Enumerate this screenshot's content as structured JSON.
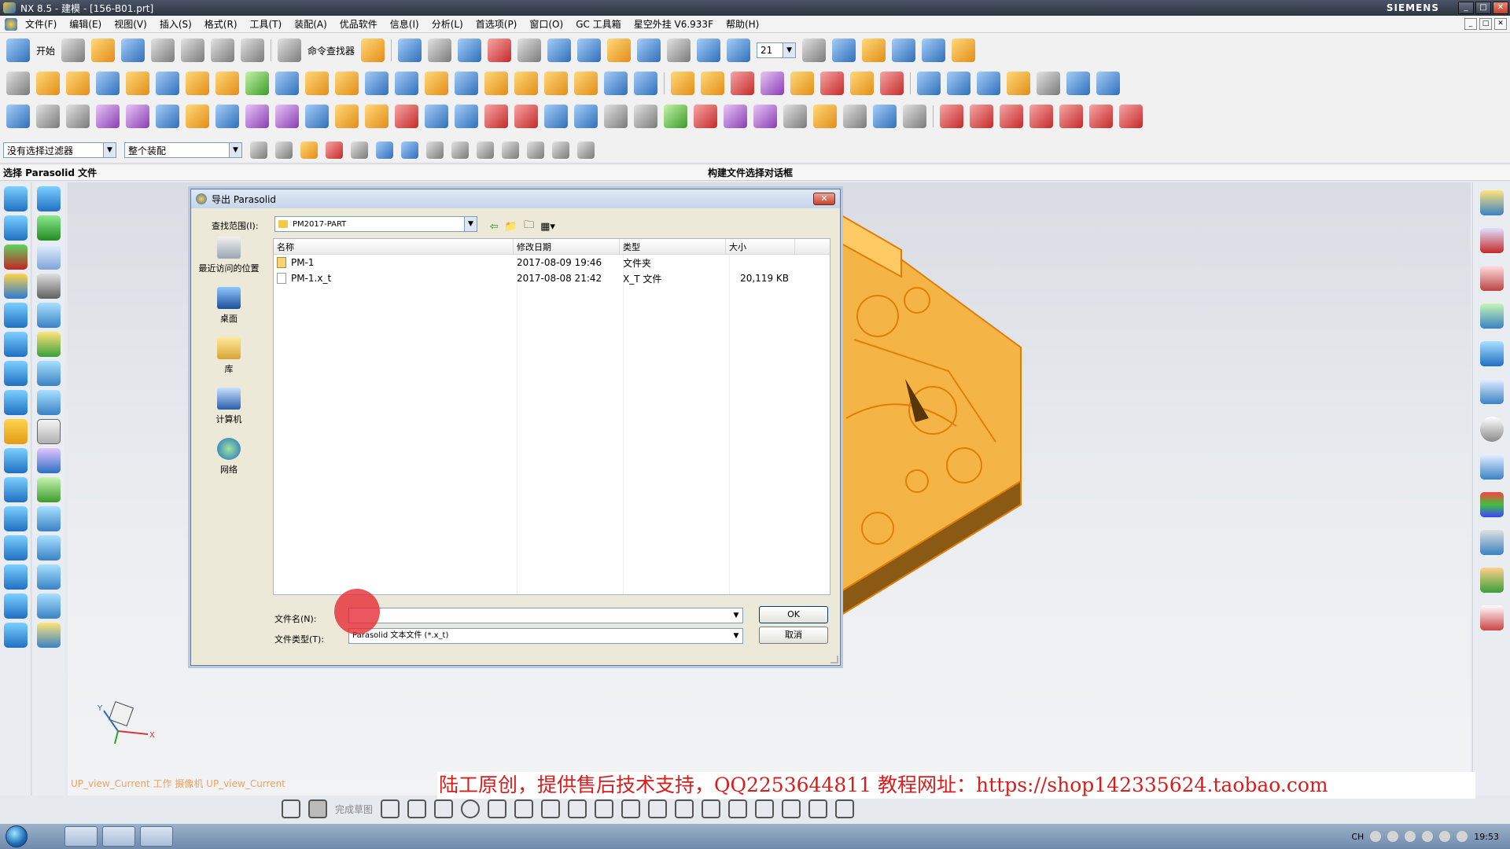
{
  "window": {
    "title": "NX 8.5 - 建模 - [156-B01.prt]",
    "brand": "SIEMENS",
    "controls": [
      "_",
      "□",
      "✕"
    ]
  },
  "menubar": {
    "items": [
      "文件(F)",
      "编辑(E)",
      "视图(V)",
      "插入(S)",
      "格式(R)",
      "工具(T)",
      "装配(A)",
      "优品软件",
      "信息(I)",
      "分析(L)",
      "首选项(P)",
      "窗口(O)",
      "GC 工具箱",
      "星空外挂 V6.933F",
      "帮助(H)"
    ]
  },
  "toolbar": {
    "start_label": "开始",
    "command_finder_label": "命令查找器",
    "layer_value": "21"
  },
  "selection_bar": {
    "filter_value": "没有选择过滤器",
    "scope_value": "整个装配"
  },
  "cue_line": {
    "cue": "选择 Parasolid 文件",
    "status": "构建文件选择对话框"
  },
  "dialog": {
    "title": "导出 Parasolid",
    "close_label": "✕",
    "look_in_label": "查找范围(I):",
    "look_in_value": "PM2017-PART",
    "places": [
      {
        "label": "最近访问的位置",
        "icon": "recent-places-icon"
      },
      {
        "label": "桌面",
        "icon": "desktop-icon"
      },
      {
        "label": "库",
        "icon": "libraries-icon"
      },
      {
        "label": "计算机",
        "icon": "computer-icon"
      },
      {
        "label": "网络",
        "icon": "network-icon"
      }
    ],
    "columns": [
      "名称",
      "修改日期",
      "类型",
      "大小"
    ],
    "files": [
      {
        "name": "PM-1",
        "date": "2017-08-09 19:46",
        "type": "文件夹",
        "size": "",
        "icon": "folder-icon"
      },
      {
        "name": "PM-1.x_t",
        "date": "2017-08-08 21:42",
        "type": "X_T 文件",
        "size": "20,119 KB",
        "icon": "file-icon"
      }
    ],
    "filename_label": "文件名(N):",
    "filename_value": "",
    "filetype_label": "文件类型(T):",
    "filetype_value": "Parasolid 文本文件 (*.x_t)",
    "ok_label": "OK",
    "cancel_label": "取消"
  },
  "viewport": {
    "view_label": "UP_view_Current 工作 摄像机 UP_view_Current",
    "axis_x": "X",
    "axis_y": "Y",
    "model_color": "#f5a623"
  },
  "watermark": {
    "text": "陆工原创，提供售后技术支持，QQ2253644811 教程网址：https://shop142335624.taobao.com"
  },
  "sketch_toolbar": {
    "finish_sketch_label": "完成草图"
  },
  "taskbar": {
    "lang": "CH",
    "time": "19:53"
  }
}
